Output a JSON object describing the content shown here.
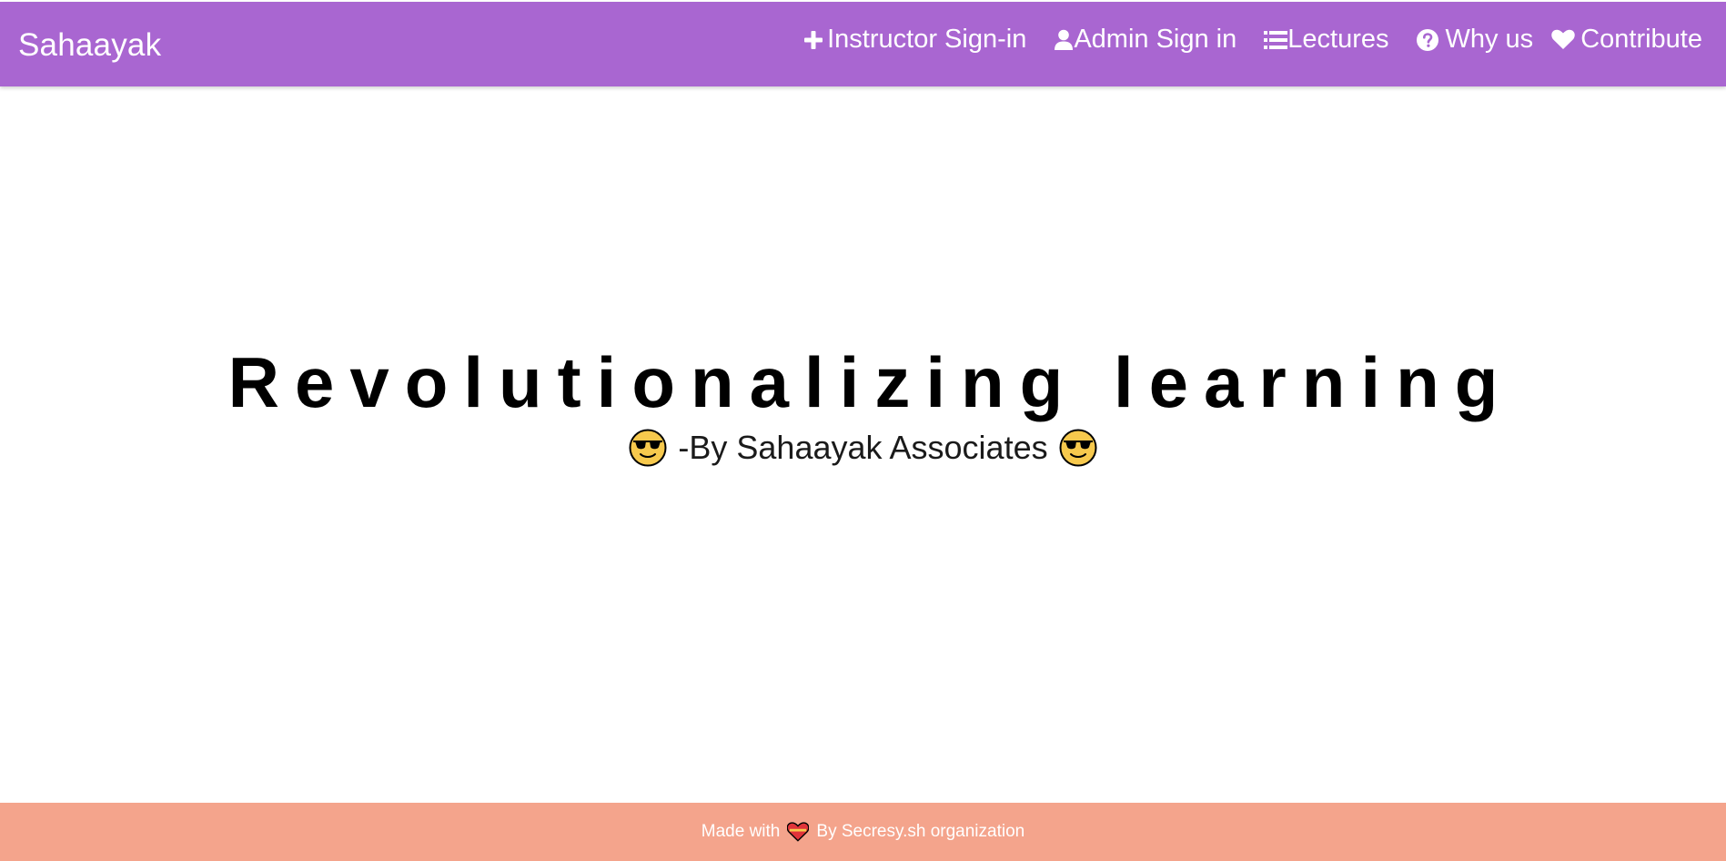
{
  "navbar": {
    "brand": "Sahaayak",
    "background": "#a966d1",
    "links": [
      {
        "label": "Instructor Sign-in",
        "icon": "plus-icon"
      },
      {
        "label": "Admin Sign in",
        "icon": "user-icon"
      },
      {
        "label": "Lectures",
        "icon": "list-icon"
      },
      {
        "label": "Why us",
        "icon": "question-circle-icon"
      },
      {
        "label": "Contribute",
        "icon": "heart-icon"
      }
    ]
  },
  "hero": {
    "title": "Revolutionalizing learning",
    "subtitle": "-By Sahaayak Associates",
    "emoji": "sunglasses-emoji"
  },
  "footer": {
    "text_before": "Made with",
    "text_after": "By Secresy.sh organization",
    "icon": "heart-emoji",
    "background": "#f4a48c"
  }
}
